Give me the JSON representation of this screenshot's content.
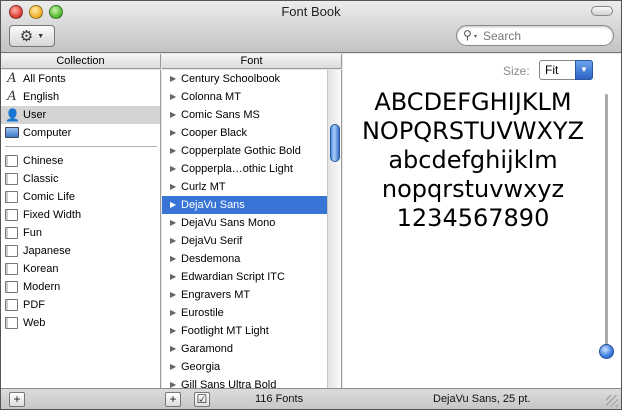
{
  "window": {
    "title": "Font Book"
  },
  "toolbar": {
    "action_icon": "gear-icon",
    "search_placeholder": "Search",
    "search_value": ""
  },
  "columns": {
    "collection_header": "Collection",
    "font_header": "Font"
  },
  "collections": {
    "top": [
      {
        "label": "All Fonts",
        "icon": "font-a-icon",
        "selected": false
      },
      {
        "label": "English",
        "icon": "font-a-icon",
        "selected": false
      },
      {
        "label": "User",
        "icon": "person-icon",
        "selected": true
      },
      {
        "label": "Computer",
        "icon": "monitor-icon",
        "selected": false
      }
    ],
    "groups": [
      {
        "label": "Chinese",
        "icon": "book-icon"
      },
      {
        "label": "Classic",
        "icon": "book-icon"
      },
      {
        "label": "Comic Life",
        "icon": "book-icon"
      },
      {
        "label": "Fixed Width",
        "icon": "book-icon"
      },
      {
        "label": "Fun",
        "icon": "book-icon"
      },
      {
        "label": "Japanese",
        "icon": "book-icon"
      },
      {
        "label": "Korean",
        "icon": "book-icon"
      },
      {
        "label": "Modern",
        "icon": "book-icon"
      },
      {
        "label": "PDF",
        "icon": "book-icon"
      },
      {
        "label": "Web",
        "icon": "book-icon"
      }
    ]
  },
  "fonts": [
    {
      "label": "Century Schoolbook",
      "selected": false
    },
    {
      "label": "Colonna MT",
      "selected": false
    },
    {
      "label": "Comic Sans MS",
      "selected": false
    },
    {
      "label": "Cooper Black",
      "selected": false
    },
    {
      "label": "Copperplate Gothic Bold",
      "selected": false
    },
    {
      "label": "Copperpla…othic Light",
      "selected": false
    },
    {
      "label": "Curlz MT",
      "selected": false
    },
    {
      "label": "DejaVu Sans",
      "selected": true
    },
    {
      "label": "DejaVu Sans Mono",
      "selected": false
    },
    {
      "label": "DejaVu Serif",
      "selected": false
    },
    {
      "label": "Desdemona",
      "selected": false
    },
    {
      "label": "Edwardian Script ITC",
      "selected": false
    },
    {
      "label": "Engravers MT",
      "selected": false
    },
    {
      "label": "Eurostile",
      "selected": false
    },
    {
      "label": "Footlight MT Light",
      "selected": false
    },
    {
      "label": "Garamond",
      "selected": false
    },
    {
      "label": "Georgia",
      "selected": false
    },
    {
      "label": "Gill Sans Ultra Bold",
      "selected": false
    }
  ],
  "preview": {
    "size_label": "Size:",
    "size_value": "Fit",
    "sample_lines": [
      "ABCDEFGHIJKLM",
      "NOPQRSTUVWXYZ",
      "abcdefghijklm",
      "nopqrstuvwxyz",
      "1234567890"
    ]
  },
  "bottom": {
    "add_collection_label": "+",
    "add_font_label": "+",
    "enable_checkbox_label": "☑",
    "font_count": "116 Fonts",
    "status": "DejaVu Sans, 25 pt."
  },
  "colors": {
    "selection": "#3875d7",
    "user_selection": "#d4d4d4"
  }
}
